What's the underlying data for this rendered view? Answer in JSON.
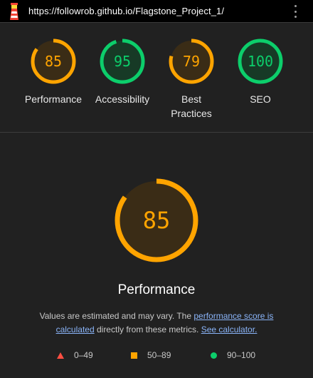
{
  "topbar": {
    "url": "https://followrob.github.io/Flagstone_Project_1/",
    "logo_icon": "lighthouse-icon",
    "menu_icon": "kebab-menu-icon"
  },
  "categories": [
    {
      "label": "Performance",
      "score": "85",
      "fraction": 0.85,
      "color": "#ffa400",
      "fill": "#3a2c16"
    },
    {
      "label": "Accessibility",
      "score": "95",
      "fraction": 0.95,
      "color": "#0cce6b",
      "fill": "#173a26"
    },
    {
      "label": "Best\nPractices",
      "score": "79",
      "fraction": 0.79,
      "color": "#ffa400",
      "fill": "#3a2c16"
    },
    {
      "label": "SEO",
      "score": "100",
      "fraction": 1.0,
      "color": "#0cce6b",
      "fill": "#173a26"
    }
  ],
  "main": {
    "score": "85",
    "fraction": 0.85,
    "title": "Performance",
    "desc_prefix": "Values are estimated and may vary. The ",
    "desc_link1": "performance score is calculated",
    "desc_middle": " directly from these metrics. ",
    "desc_link2": "See calculator."
  },
  "legend": [
    {
      "icon": "red-triangle-icon",
      "range": "0–49",
      "color": "#ff4e42"
    },
    {
      "icon": "orange-square-icon",
      "range": "50–89",
      "color": "#ffa400"
    },
    {
      "icon": "green-circle-icon",
      "range": "90–100",
      "color": "#0cce6b"
    }
  ]
}
